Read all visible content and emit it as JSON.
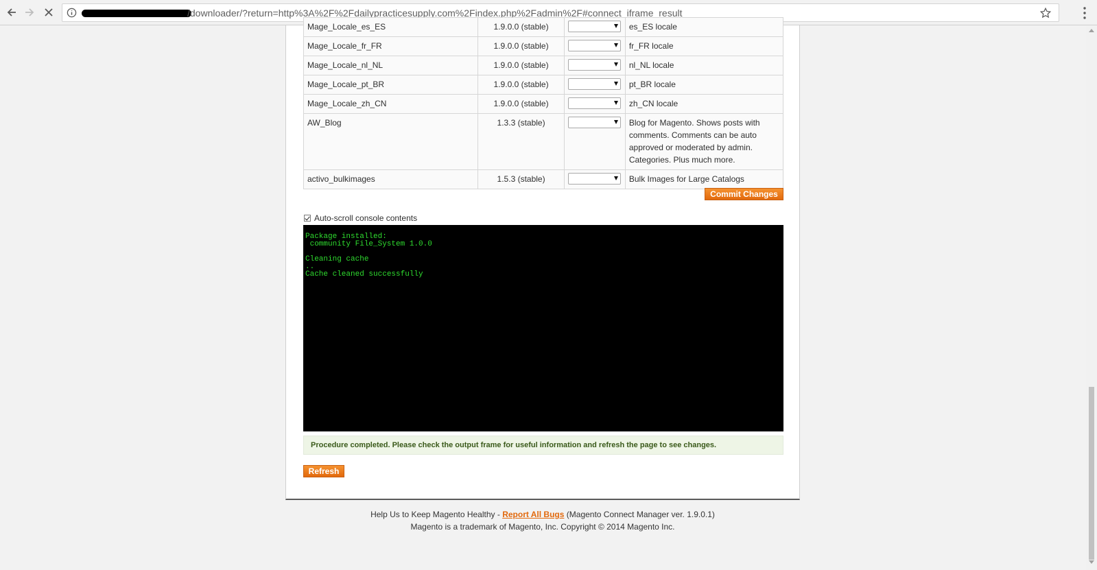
{
  "browser": {
    "url": "/downloader/?return=http%3A%2F%2Fdailypracticesupply.com%2Findex.php%2Fadmin%2F#connect_iframe_result",
    "url_redacted": "(redacted)"
  },
  "packages": [
    {
      "name": "Mage_Locale_es_ES",
      "version": "1.9.0.0 (stable)",
      "description": "es_ES locale"
    },
    {
      "name": "Mage_Locale_fr_FR",
      "version": "1.9.0.0 (stable)",
      "description": "fr_FR locale"
    },
    {
      "name": "Mage_Locale_nl_NL",
      "version": "1.9.0.0 (stable)",
      "description": "nl_NL locale"
    },
    {
      "name": "Mage_Locale_pt_BR",
      "version": "1.9.0.0 (stable)",
      "description": "pt_BR locale"
    },
    {
      "name": "Mage_Locale_zh_CN",
      "version": "1.9.0.0 (stable)",
      "description": "zh_CN locale"
    },
    {
      "name": "AW_Blog",
      "version": "1.3.3 (stable)",
      "description": "Blog for Magento. Shows posts with comments. Comments can be auto approved or moderated by admin. Categories. Plus much more."
    },
    {
      "name": "activo_bulkimages",
      "version": "1.5.3 (stable)",
      "description": "Bulk Images for Large Catalogs"
    }
  ],
  "actions": {
    "commit_label": "Commit Changes",
    "refresh_label": "Refresh"
  },
  "console": {
    "autoscroll_label": "Auto-scroll console contents",
    "autoscroll_checked": true,
    "lines": "Package installed:\n community File_System 1.0.0\n\nCleaning cache\n..\nCache cleaned successfully"
  },
  "notice": "Procedure completed. Please check the output frame for useful information and refresh the page to see changes.",
  "footer": {
    "help_prefix": "Help Us to Keep Magento Healthy -",
    "report_link": "Report All Bugs",
    "version_text": "(Magento Connect Manager ver. 1.9.0.1)",
    "copyright": "Magento is a trademark of Magento, Inc. Copyright © 2014 Magento Inc."
  },
  "colors": {
    "accent": "#f1812b",
    "console_bg": "#000000",
    "console_text": "#2fdc2f",
    "notice_bg": "#eef5e6"
  }
}
